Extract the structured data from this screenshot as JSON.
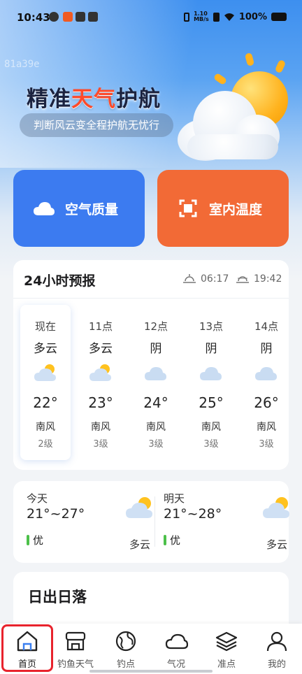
{
  "status_bar": {
    "time": "10:43",
    "network_speed_top": "1.10",
    "network_speed_bottom": "MB/s",
    "battery": "100%"
  },
  "watermark": "81a39e",
  "hero": {
    "slogan_part1": "精准",
    "slogan_part2": "天气",
    "slogan_part3": "护航",
    "subtitle": "判断风云变全程护航无忧行"
  },
  "tiles": {
    "air_quality": "空气质量",
    "indoor_temp": "室内温度"
  },
  "forecast": {
    "title": "24小时预报",
    "sunrise": "06:17",
    "sunset": "19:42",
    "hours": [
      {
        "label": "现在",
        "condition": "多云",
        "temp": "22°",
        "wind": "南风",
        "level": "2级",
        "icon": "partly-cloudy-icon"
      },
      {
        "label": "11点",
        "condition": "多云",
        "temp": "23°",
        "wind": "南风",
        "level": "3级",
        "icon": "partly-cloudy-icon"
      },
      {
        "label": "12点",
        "condition": "阴",
        "temp": "24°",
        "wind": "南风",
        "level": "3级",
        "icon": "overcast-icon"
      },
      {
        "label": "13点",
        "condition": "阴",
        "temp": "25°",
        "wind": "南风",
        "level": "3级",
        "icon": "overcast-icon"
      },
      {
        "label": "14点",
        "condition": "阴",
        "temp": "26°",
        "wind": "南风",
        "level": "3级",
        "icon": "overcast-icon"
      }
    ]
  },
  "days": {
    "today": {
      "name": "今天",
      "range": "21°~27°",
      "aqi": "优",
      "condition": "多云"
    },
    "tomorrow": {
      "name": "明天",
      "range": "21°~28°",
      "aqi": "优",
      "condition": "多云"
    }
  },
  "sun_section": {
    "title": "日出日落"
  },
  "nav": {
    "items": [
      {
        "label": "首页",
        "icon": "home-icon"
      },
      {
        "label": "钓鱼天气",
        "icon": "store-icon"
      },
      {
        "label": "钓点",
        "icon": "globe-icon"
      },
      {
        "label": "气况",
        "icon": "cloud-icon"
      },
      {
        "label": "准点",
        "icon": "layers-icon"
      },
      {
        "label": "我的",
        "icon": "user-icon"
      }
    ]
  },
  "colors": {
    "air_tile": "#3c7bf0",
    "indoor_tile": "#f26a36",
    "highlight": "#e8232d",
    "aqi_good": "#4cc04a"
  }
}
